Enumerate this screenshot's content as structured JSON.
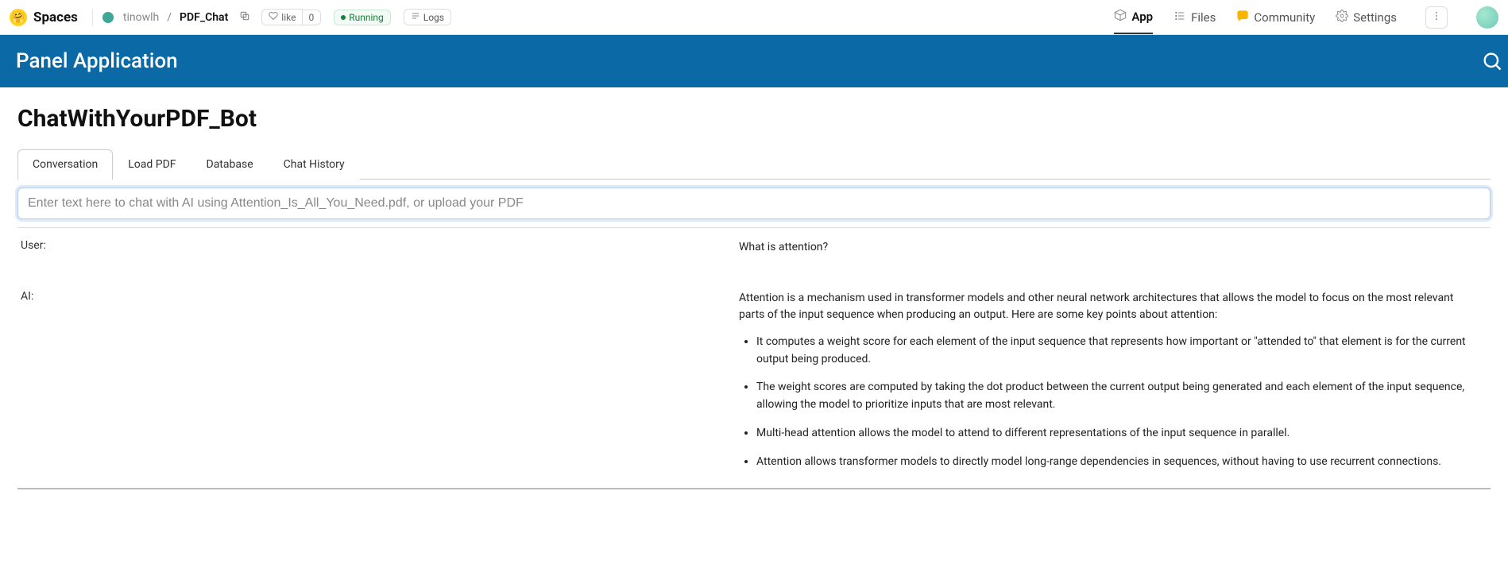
{
  "topbar": {
    "spaces_label": "Spaces",
    "owner": "tinowlh",
    "repo": "PDF_Chat",
    "like_label": "like",
    "like_count": "0",
    "status": "Running",
    "logs_label": "Logs"
  },
  "nav": {
    "app": "App",
    "files": "Files",
    "community": "Community",
    "settings": "Settings"
  },
  "panel": {
    "title": "Panel Application"
  },
  "page": {
    "title": "ChatWithYourPDF_Bot"
  },
  "tabs": [
    {
      "label": "Conversation"
    },
    {
      "label": "Load PDF"
    },
    {
      "label": "Database"
    },
    {
      "label": "Chat History"
    }
  ],
  "input": {
    "placeholder": "Enter text here to chat with AI using Attention_Is_All_You_Need.pdf, or upload your PDF"
  },
  "conversation": {
    "user_label": "User:",
    "user_msg": "What is attention?",
    "ai_label": "AI:",
    "ai_intro": "Attention is a mechanism used in transformer models and other neural network architectures that allows the model to focus on the most relevant parts of the input sequence when producing an output. Here are some key points about attention:",
    "ai_points": [
      "It computes a weight score for each element of the input sequence that represents how important or \"attended to\" that element is for the current output being produced.",
      "The weight scores are computed by taking the dot product between the current output being generated and each element of the input sequence, allowing the model to prioritize inputs that are most relevant.",
      "Multi-head attention allows the model to attend to different representations of the input sequence in parallel.",
      "Attention allows transformer models to directly model long-range dependencies in sequences, without having to use recurrent connections."
    ]
  }
}
